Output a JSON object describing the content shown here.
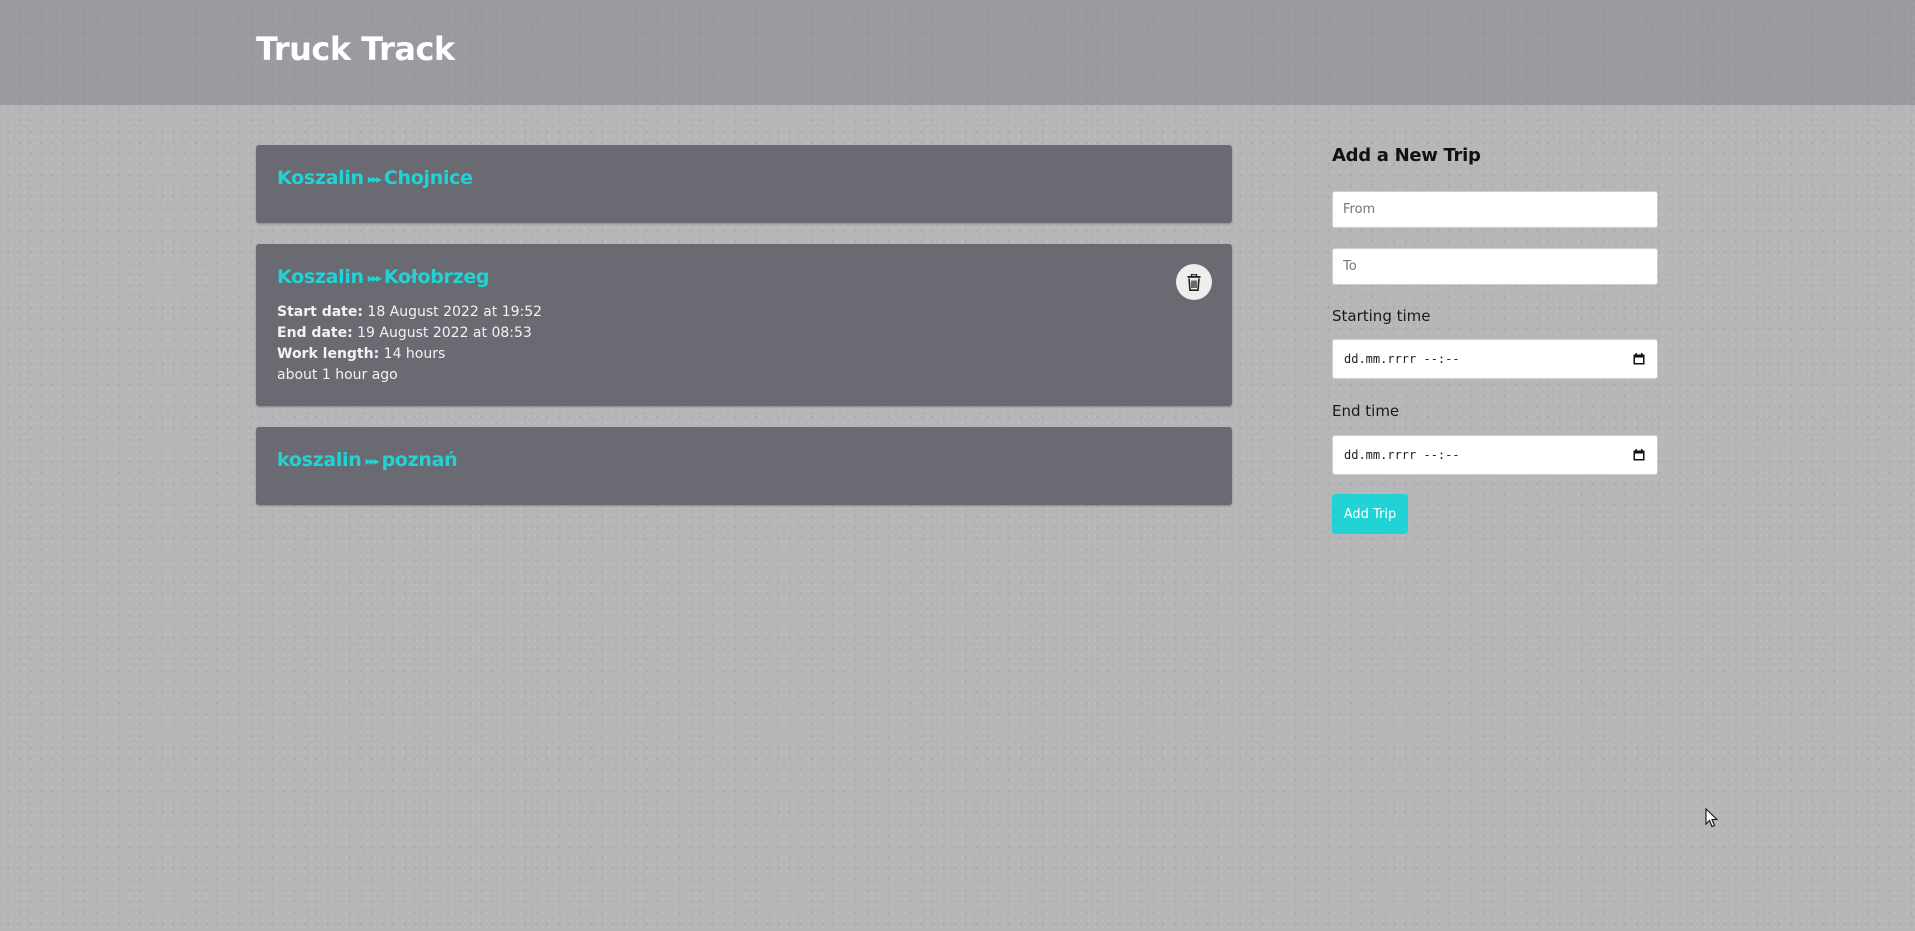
{
  "app": {
    "title": "Truck Track"
  },
  "trips": [
    {
      "from": "Koszalin",
      "to": "Chojnice"
    },
    {
      "from": "Koszalin",
      "to": "Kołobrzeg",
      "start_label": "Start date:",
      "start_value": "18 August 2022 at 19:52",
      "end_label": "End date:",
      "end_value": "19 August 2022 at 08:53",
      "length_label": "Work length:",
      "length_value": "14 hours",
      "relative_time": "about 1 hour ago"
    },
    {
      "from": "koszalin",
      "to": "poznań"
    }
  ],
  "route_arrow": "▸▸▸",
  "icons": {
    "delete": "trash-icon",
    "calendar": "calendar-icon",
    "cursor": "mouse-pointer-icon"
  },
  "form": {
    "title": "Add a New Trip",
    "from_placeholder": "From",
    "to_placeholder": "To",
    "start_label": "Starting time",
    "start_value": "dd.mm.rrrr --:--",
    "end_label": "End time",
    "end_value": "dd.mm.rrrr --:--",
    "submit_label": "Add Trip"
  },
  "colors": {
    "accent": "#22d3d5",
    "card_bg": "#5f6068",
    "header_bg": "#8f9096",
    "page_bg": "#b6b6b8"
  }
}
